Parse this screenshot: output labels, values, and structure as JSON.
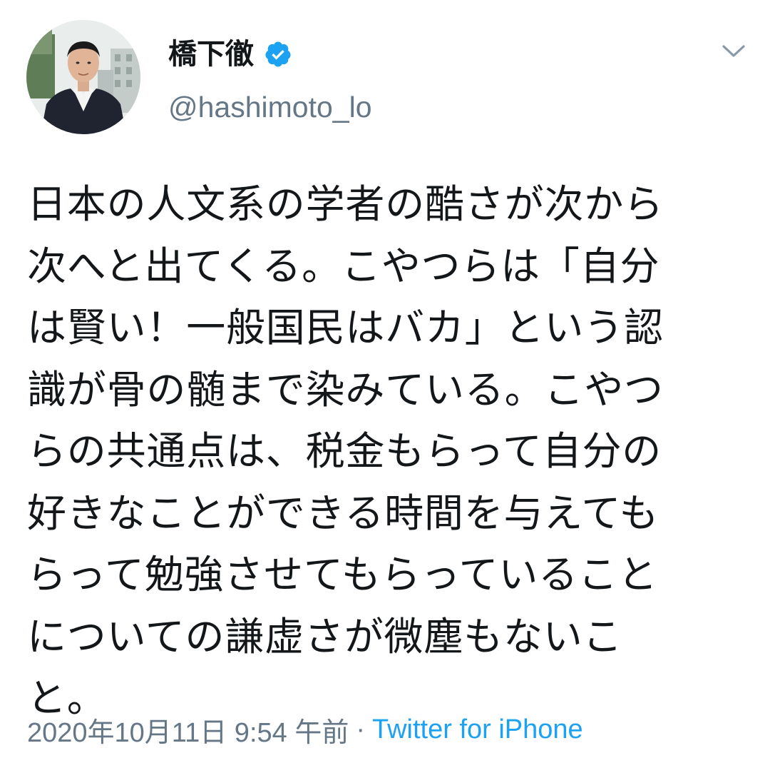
{
  "tweet": {
    "author": {
      "display_name": "橋下徹",
      "handle": "@hashimoto_lo",
      "verified": true,
      "avatar_icon": "user-photo-avatar"
    },
    "text_lines": [
      "日本の人文系の学者の酷さが次から",
      "次へと出てくる。こやつらは「自分",
      "は賢い！一般国民はバカ」という認",
      "識が骨の髄まで染みている。こやつ",
      "らの共通点は、税金もらって自分の",
      "好きなことができる時間を与えても",
      "らって勉強させてもらっていること",
      "についての謙虚さが微塵もないこ",
      "と。"
    ],
    "timestamp": "2020年10月11日 9:54 午前",
    "separator": "·",
    "source": "Twitter for iPhone",
    "menu_icon": "chevron-down-icon"
  },
  "colors": {
    "text": "#14171a",
    "secondary": "#657786",
    "link": "#1da1f2",
    "verified": "#1da1f2"
  }
}
